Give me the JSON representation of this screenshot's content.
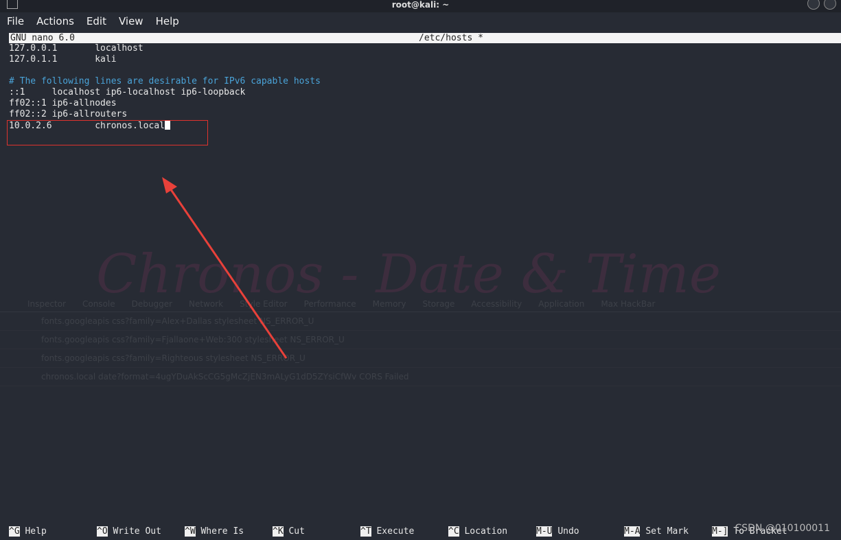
{
  "window": {
    "title": "root@kali: ~"
  },
  "menu": [
    "File",
    "Actions",
    "Edit",
    "View",
    "Help"
  ],
  "nano": {
    "version": "GNU nano 6.0",
    "filename": "/etc/hosts *"
  },
  "lines": [
    {
      "text": "127.0.0.1       localhost",
      "type": "normal"
    },
    {
      "text": "127.0.1.1       kali",
      "type": "normal"
    },
    {
      "text": "",
      "type": "normal"
    },
    {
      "text": "# The following lines are desirable for IPv6 capable hosts",
      "type": "comment"
    },
    {
      "text": "::1     localhost ip6-localhost ip6-loopback",
      "type": "normal"
    },
    {
      "text": "ff02::1 ip6-allnodes",
      "type": "normal"
    },
    {
      "text": "ff02::2 ip6-allrouters",
      "type": "normal"
    },
    {
      "text": "10.0.2.6        chronos.local",
      "type": "highlighted"
    }
  ],
  "background": {
    "watermark": "Chronos - Date & Time",
    "devtools_tabs": [
      "Inspector",
      "Console",
      "Debugger",
      "Network",
      "Style Editor",
      "Performance",
      "Memory",
      "Storage",
      "Accessibility",
      "Application",
      "Max HackBar"
    ],
    "requests": [
      "fonts.googleapis  css?family=Alex+Dallas  stylesheet  NS_ERROR_U",
      "fonts.googleapis  css?family=Fjallaone+Web:300  stylesheet  NS_ERROR_U",
      "fonts.googleapis  css?family=Righteous  stylesheet  NS_ERROR_U",
      "chronos.local  date?format=4ugYDuAkScCG5gMcZjEN3mALyG1dD5ZYsiCfWv  CORS Failed"
    ]
  },
  "shortcuts": [
    {
      "key": "^G",
      "label": "Help"
    },
    {
      "key": "^O",
      "label": "Write Out"
    },
    {
      "key": "^W",
      "label": "Where Is"
    },
    {
      "key": "^K",
      "label": "Cut"
    },
    {
      "key": "^T",
      "label": "Execute"
    },
    {
      "key": "^C",
      "label": "Location"
    },
    {
      "key": "M-U",
      "label": "Undo"
    },
    {
      "key": "M-A",
      "label": "Set Mark"
    },
    {
      "key": "M-]",
      "label": "To Bracket"
    }
  ],
  "csdn_watermark": "CSDN @010100011",
  "colors": {
    "comment": "#4aa3d8",
    "annotation": "#e0332e"
  }
}
